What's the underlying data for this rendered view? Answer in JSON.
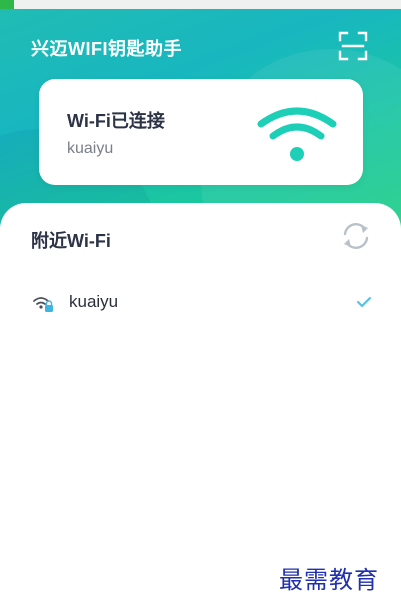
{
  "header": {
    "title": "兴迈WIFI钥匙助手",
    "scan_icon": "scan-frame-icon"
  },
  "status_card": {
    "title": "Wi-Fi已连接",
    "ssid": "kuaiyu",
    "icon": "wifi-signal-icon"
  },
  "nearby": {
    "title": "附近Wi-Fi",
    "refresh_icon": "refresh-icon",
    "networks": [
      {
        "ssid": "kuaiyu",
        "locked": true,
        "connected": true,
        "icon": "wifi-lock-icon",
        "status_icon": "check-icon"
      }
    ]
  },
  "watermark": "最需教育",
  "colors": {
    "accent": "#1ec9a8",
    "hero_start": "#20bcb4",
    "hero_end": "#22cf86",
    "text_dark": "#2c3347",
    "check": "#4fc0e6",
    "watermark": "#1f2fb0"
  }
}
